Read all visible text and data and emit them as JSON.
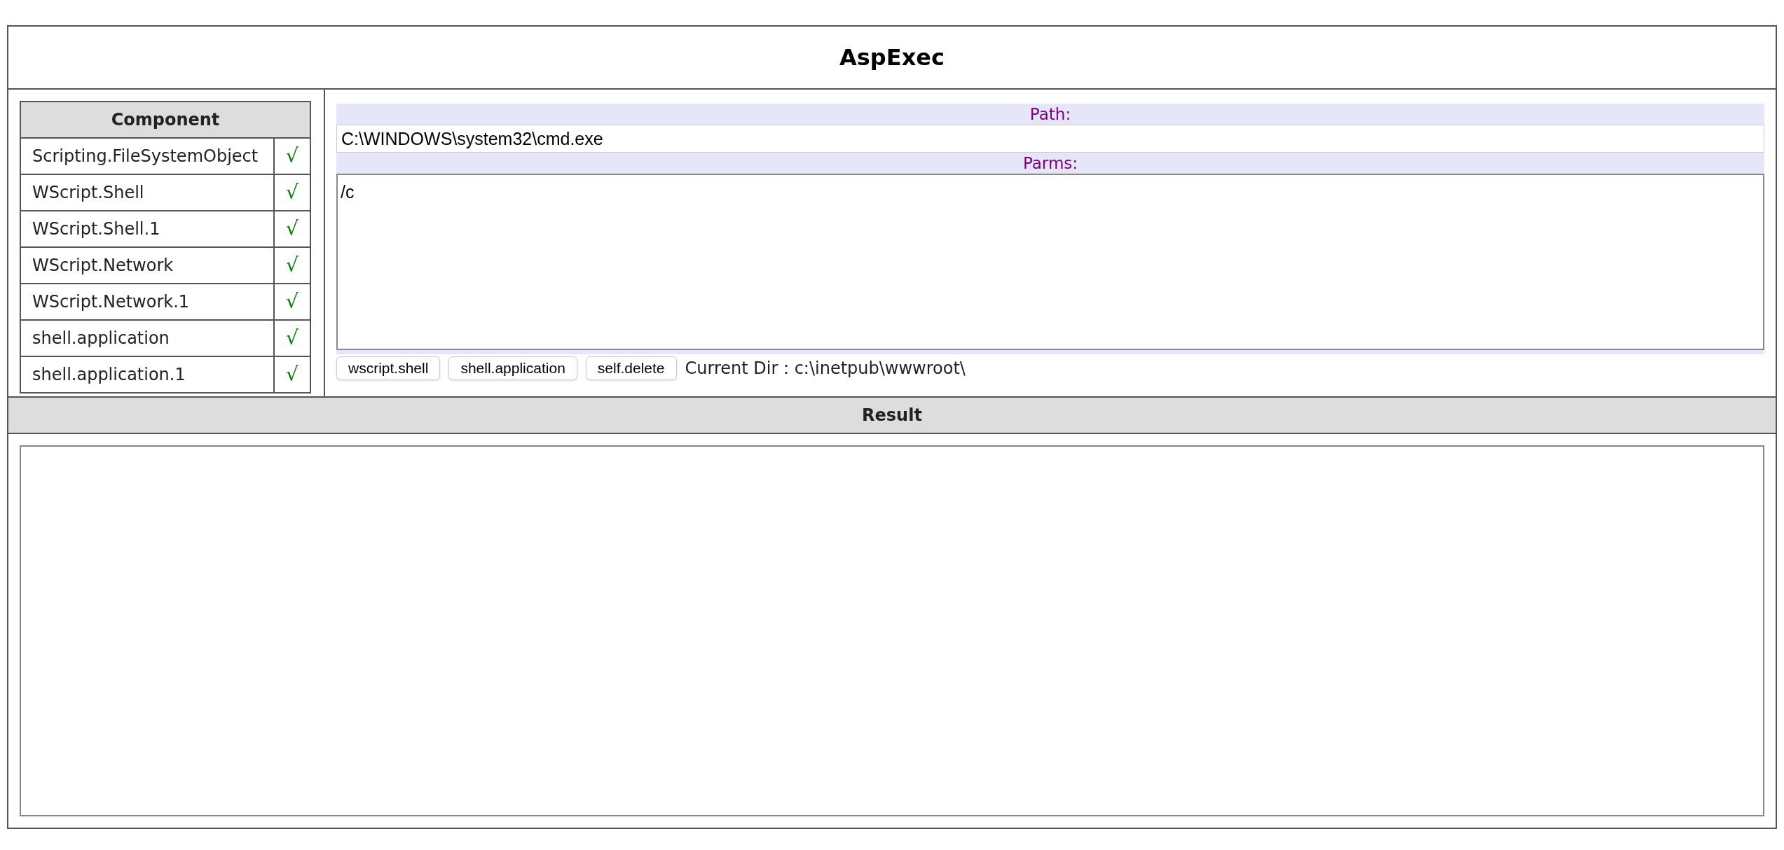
{
  "title": "AspExec",
  "components": {
    "heading": "Component",
    "rows": [
      {
        "name": "Scripting.FileSystemObject",
        "status": "√"
      },
      {
        "name": "WScript.Shell",
        "status": "√"
      },
      {
        "name": "WScript.Shell.1",
        "status": "√"
      },
      {
        "name": "WScript.Network",
        "status": "√"
      },
      {
        "name": "WScript.Network.1",
        "status": "√"
      },
      {
        "name": "shell.application",
        "status": "√"
      },
      {
        "name": "shell.application.1",
        "status": "√"
      }
    ]
  },
  "path": {
    "label": "Path:",
    "value": "C:\\WINDOWS\\system32\\cmd.exe"
  },
  "parms": {
    "label": "Parms:",
    "value": "/c"
  },
  "buttons": [
    "wscript.shell",
    "shell.application",
    "self.delete"
  ],
  "current_dir": "Current Dir : c:\\inetpub\\wwwroot\\",
  "result": {
    "heading": "Result"
  }
}
